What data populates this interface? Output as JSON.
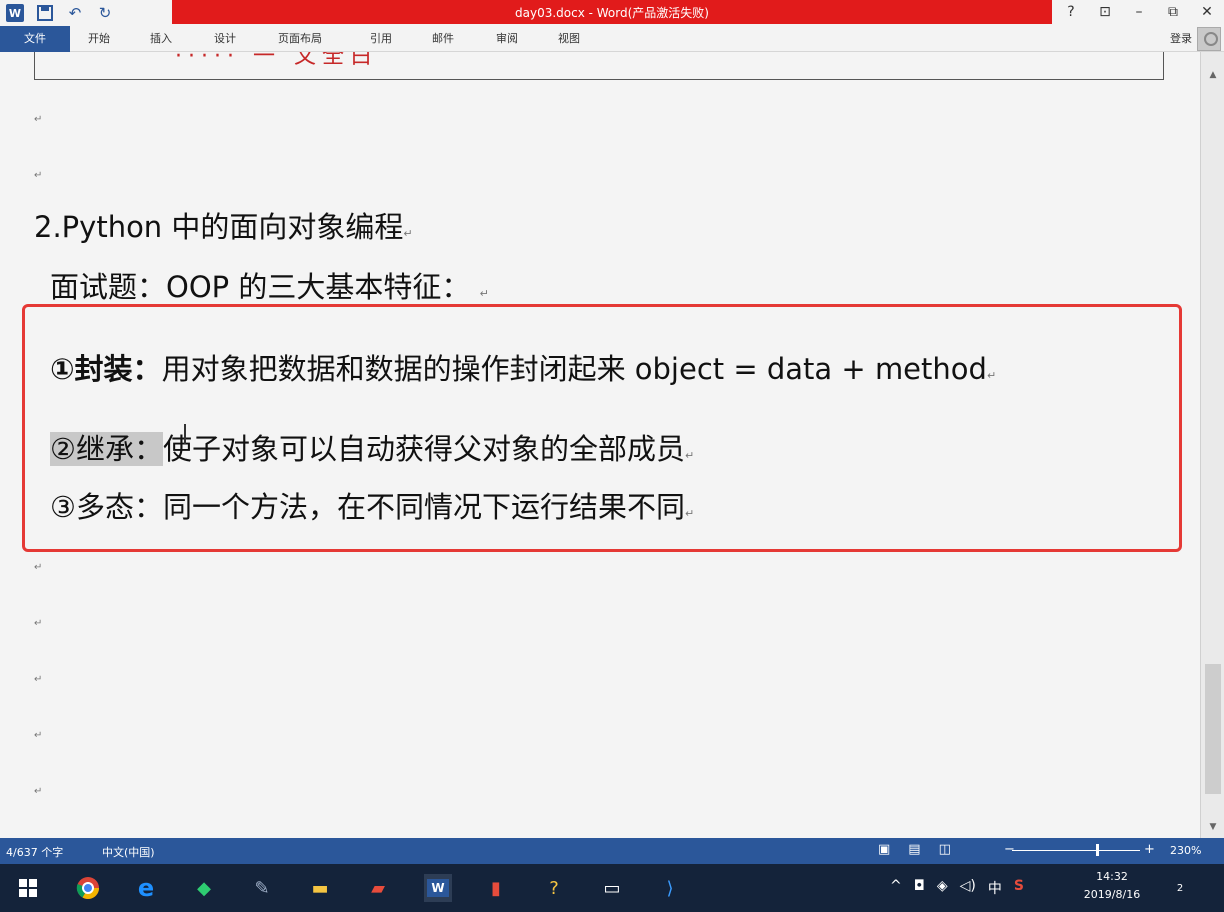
{
  "window": {
    "title": "day03.docx - Word(产品激活失败)",
    "controls": [
      "?",
      "⊡",
      "–",
      "⧉",
      "✕"
    ]
  },
  "ribbon": {
    "file_tab": "文件",
    "tabs": [
      "开始",
      "插入",
      "设计",
      "页面布局",
      "引用",
      "邮件",
      "审阅",
      "视图"
    ],
    "login": "登录"
  },
  "document": {
    "cutoff_text": "····· 一 文全白",
    "paragraph_mark": "↵",
    "heading": "2.Python 中的面向对象编程",
    "subheading": "面试题：OOP 的三大基本特征：",
    "items": [
      {
        "label": "①封装：",
        "text": "用对象把数据和数据的操作封闭起来  object = data + method"
      },
      {
        "label": "②继承：",
        "text": "使子对象可以自动获得父对象的全部成员"
      },
      {
        "label": "③多态：",
        "text": "同一个方法，在不同情况下运行结果不同"
      }
    ]
  },
  "status_bar": {
    "word_count": "4/637 个字",
    "language": "中文(中国)",
    "zoom": "230%"
  },
  "taskbar": {
    "time": "14:32",
    "date": "2019/8/16",
    "ime": "中",
    "notifications": "2"
  },
  "colors": {
    "accent": "#2b579a",
    "title_bar_red": "#e11b1b",
    "highlight_box": "#e53935"
  }
}
